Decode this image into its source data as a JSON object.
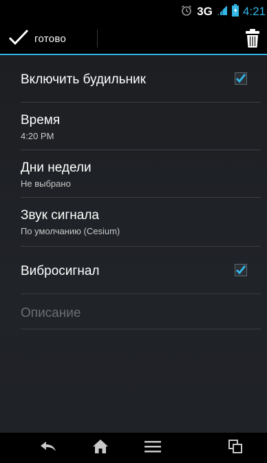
{
  "status_bar": {
    "alarm_icon": "alarm-clock-icon",
    "network_label": "3G",
    "signal_icon": "signal-icon",
    "battery_icon": "battery-icon",
    "time": "4:21"
  },
  "action_bar": {
    "done_label": "готово",
    "done_icon": "checkmark-icon",
    "delete_icon": "trash-icon"
  },
  "settings": {
    "enable_alarm": {
      "label": "Включить будильник",
      "checked": true
    },
    "time": {
      "label": "Время",
      "value": "4:20 PM"
    },
    "weekdays": {
      "label": "Дни недели",
      "value": "Не выбрано"
    },
    "ringtone": {
      "label": "Звук сигнала",
      "value": "По умолчанию (Cesium)"
    },
    "vibrate": {
      "label": "Вибросигнал",
      "checked": true
    },
    "description": {
      "placeholder": "Описание"
    }
  },
  "nav_bar": {
    "back_icon": "back-icon",
    "home_icon": "home-icon",
    "menu_icon": "menu-icon",
    "recents_icon": "recent-apps-icon"
  },
  "colors": {
    "accent": "#33b5e5",
    "background": "#1f2227",
    "divider": "#3a3d42"
  }
}
